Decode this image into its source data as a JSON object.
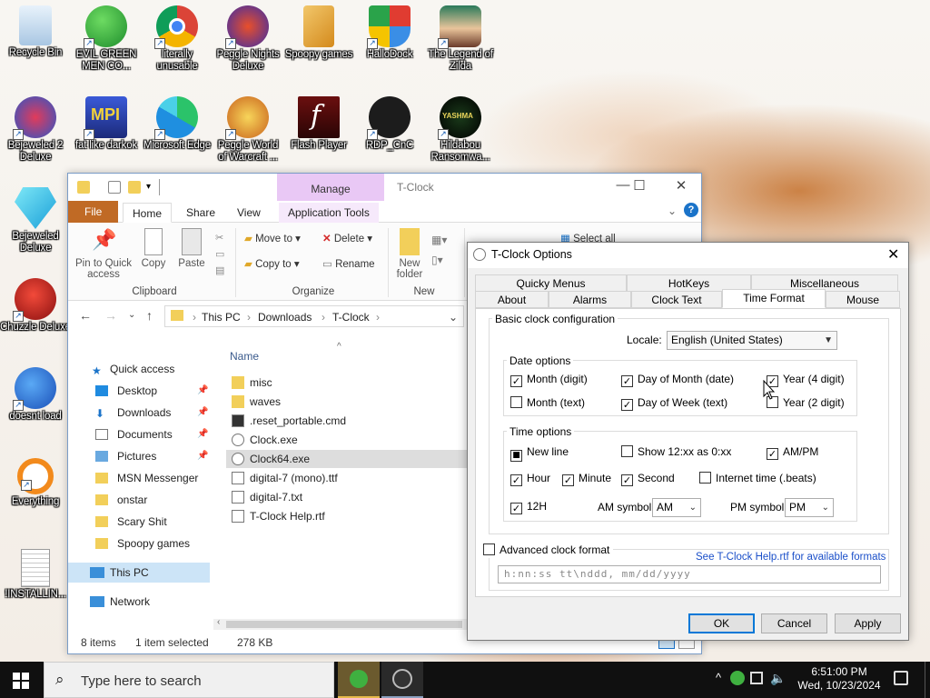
{
  "desktop": {
    "icons": [
      {
        "label": "Recycle Bin",
        "name": "recycle-bin-icon"
      },
      {
        "label": "EVIL GREEN MEN CO...",
        "name": "evil-green-men-icon"
      },
      {
        "label": "literally unusable",
        "name": "chrome-icon"
      },
      {
        "label": "Peggle Nights Deluxe",
        "name": "peggle-nights-icon"
      },
      {
        "label": "Spoopy games",
        "name": "spoopy-games-icon"
      },
      {
        "label": "HalloDock",
        "name": "hallodock-icon"
      },
      {
        "label": "The Legend of Zilda",
        "name": "legend-zilda-icon"
      },
      {
        "label": "Bejeweled 2 Deluxe",
        "name": "bejeweled2-icon"
      },
      {
        "label": "fat like darkok",
        "name": "mpi-icon"
      },
      {
        "label": "Microsoft Edge",
        "name": "edge-icon"
      },
      {
        "label": "Peggle World of Warcraft ...",
        "name": "peggle-wow-icon"
      },
      {
        "label": "Flash Player",
        "name": "flash-player-icon"
      },
      {
        "label": "RDP_CnC",
        "name": "rdp-cnc-icon"
      },
      {
        "label": "Hildabou Ransomwa...",
        "name": "hildabou-icon"
      },
      {
        "label": "Bejeweled Deluxe",
        "name": "bejeweled-icon"
      },
      {
        "label": "Chuzzle Deluxe",
        "name": "chuzzle-icon"
      },
      {
        "label": "doesnt load",
        "name": "thunderbird-icon"
      },
      {
        "label": "Everything",
        "name": "everything-icon"
      },
      {
        "label": "!INSTALLIN...",
        "name": "install-file-icon"
      }
    ]
  },
  "explorer": {
    "contextual_tab": "Manage",
    "title": "T-Clock",
    "tabs": {
      "file": "File",
      "home": "Home",
      "share": "Share",
      "view": "View",
      "app_tools": "Application Tools"
    },
    "ribbon": {
      "pin": "Pin to Quick access",
      "copy": "Copy",
      "paste": "Paste",
      "move_to": "Move to",
      "copy_to": "Copy to",
      "delete": "Delete",
      "rename": "Rename",
      "new_folder": "New folder",
      "select_all": "Select all",
      "group_clipboard": "Clipboard",
      "group_organize": "Organize",
      "group_new": "New"
    },
    "address": [
      "This PC",
      "Downloads",
      "T-Clock"
    ],
    "nav": [
      {
        "label": "Quick access",
        "pin": false
      },
      {
        "label": "Desktop",
        "pin": true
      },
      {
        "label": "Downloads",
        "pin": true
      },
      {
        "label": "Documents",
        "pin": true
      },
      {
        "label": "Pictures",
        "pin": true
      },
      {
        "label": "MSN Messenger",
        "pin": false
      },
      {
        "label": "onstar",
        "pin": false
      },
      {
        "label": "Scary Shit",
        "pin": false
      },
      {
        "label": "Spoopy games",
        "pin": false
      },
      {
        "label": "This PC",
        "pin": false
      },
      {
        "label": "Network",
        "pin": false
      }
    ],
    "column_name": "Name",
    "files": [
      {
        "name": "misc",
        "type": "folder"
      },
      {
        "name": "waves",
        "type": "folder"
      },
      {
        "name": ".reset_portable.cmd",
        "type": "cmd"
      },
      {
        "name": "Clock.exe",
        "type": "exe"
      },
      {
        "name": "Clock64.exe",
        "type": "exe"
      },
      {
        "name": "digital-7 (mono).ttf",
        "type": "ttf"
      },
      {
        "name": "digital-7.txt",
        "type": "txt"
      },
      {
        "name": "T-Clock Help.rtf",
        "type": "rtf"
      }
    ],
    "status": {
      "items": "8 items",
      "selected": "1 item selected",
      "size": "278 KB"
    }
  },
  "dialog": {
    "title": "T-Clock Options",
    "tabs_row1": [
      "Quicky Menus",
      "HotKeys",
      "Miscellaneous"
    ],
    "tabs_row2": [
      "About",
      "Alarms",
      "Clock Text",
      "Time Format",
      "Mouse"
    ],
    "basic_group": "Basic clock configuration",
    "locale_label": "Locale:",
    "locale_value": "English (United States)",
    "date_group": "Date options",
    "date_opts": {
      "month_digit": "Month (digit)",
      "day_of_month": "Day of Month (date)",
      "year4": "Year (4 digit)",
      "month_text": "Month (text)",
      "day_of_week": "Day of Week (text)",
      "year2": "Year (2 digit)"
    },
    "time_group": "Time options",
    "time_opts": {
      "new_line": "New line",
      "show12": "Show 12:xx as 0:xx",
      "ampm": "AM/PM",
      "hour": "Hour",
      "minute": "Minute",
      "second": "Second",
      "internet_time": "Internet time (.beats)",
      "h12": "12H"
    },
    "am_label": "AM symbol:",
    "am_value": "AM",
    "pm_label": "PM symbol:",
    "pm_value": "PM",
    "advanced_label": "Advanced clock format",
    "help_link": "See T-Clock Help.rtf for available formats",
    "format_placeholder": "h:nn:ss tt\\nddd, mm/dd/yyyy",
    "ok": "OK",
    "cancel": "Cancel",
    "apply": "Apply"
  },
  "taskbar": {
    "search_placeholder": "Type here to search",
    "time": "6:51:00 PM",
    "date": "Wed, 10/23/2024"
  }
}
